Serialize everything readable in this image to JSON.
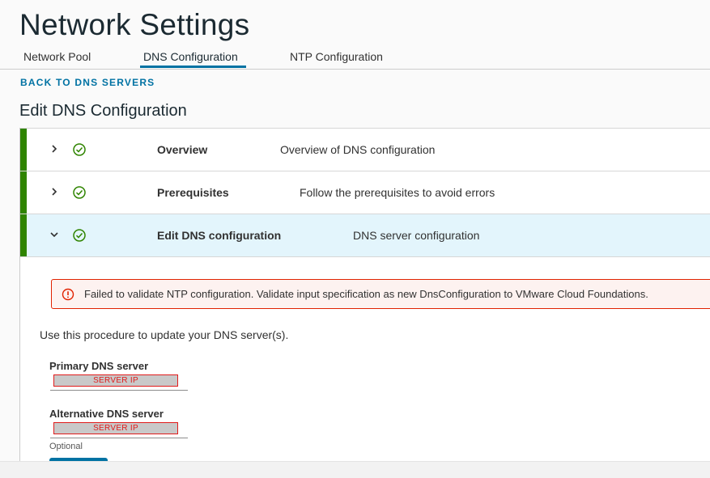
{
  "page": {
    "title": "Network Settings"
  },
  "tabs": [
    {
      "label": "Network Pool",
      "active": false
    },
    {
      "label": "DNS Configuration",
      "active": true
    },
    {
      "label": "NTP Configuration",
      "active": false
    }
  ],
  "back_link": "BACK TO DNS SERVERS",
  "section_title": "Edit DNS Configuration",
  "steps": [
    {
      "label": "Overview",
      "description": "Overview of DNS configuration",
      "status": "complete",
      "expanded": false,
      "icon": "chevron-right-icon"
    },
    {
      "label": "Prerequisites",
      "description": "Follow the prerequisites to avoid errors",
      "status": "complete",
      "expanded": false,
      "icon": "chevron-right-icon"
    },
    {
      "label": "Edit DNS configuration",
      "description": "DNS server configuration",
      "status": "complete",
      "expanded": true,
      "icon": "chevron-down-icon"
    }
  ],
  "alert": {
    "type": "error",
    "icon": "exclamation-circle-icon",
    "message": "Failed to validate NTP configuration. Validate input specification as new DnsConfiguration to VMware Cloud Foundations."
  },
  "form": {
    "intro": "Use this procedure to update your DNS server(s).",
    "primary": {
      "label": "Primary DNS server",
      "value": "SERVER IP"
    },
    "alternative": {
      "label": "Alternative DNS server",
      "value": "SERVER IP",
      "helper": "Optional"
    }
  },
  "colors": {
    "accent": "#0072a3",
    "success": "#2f8400",
    "danger": "#e12200",
    "expanded_bg": "#e3f5fc"
  }
}
